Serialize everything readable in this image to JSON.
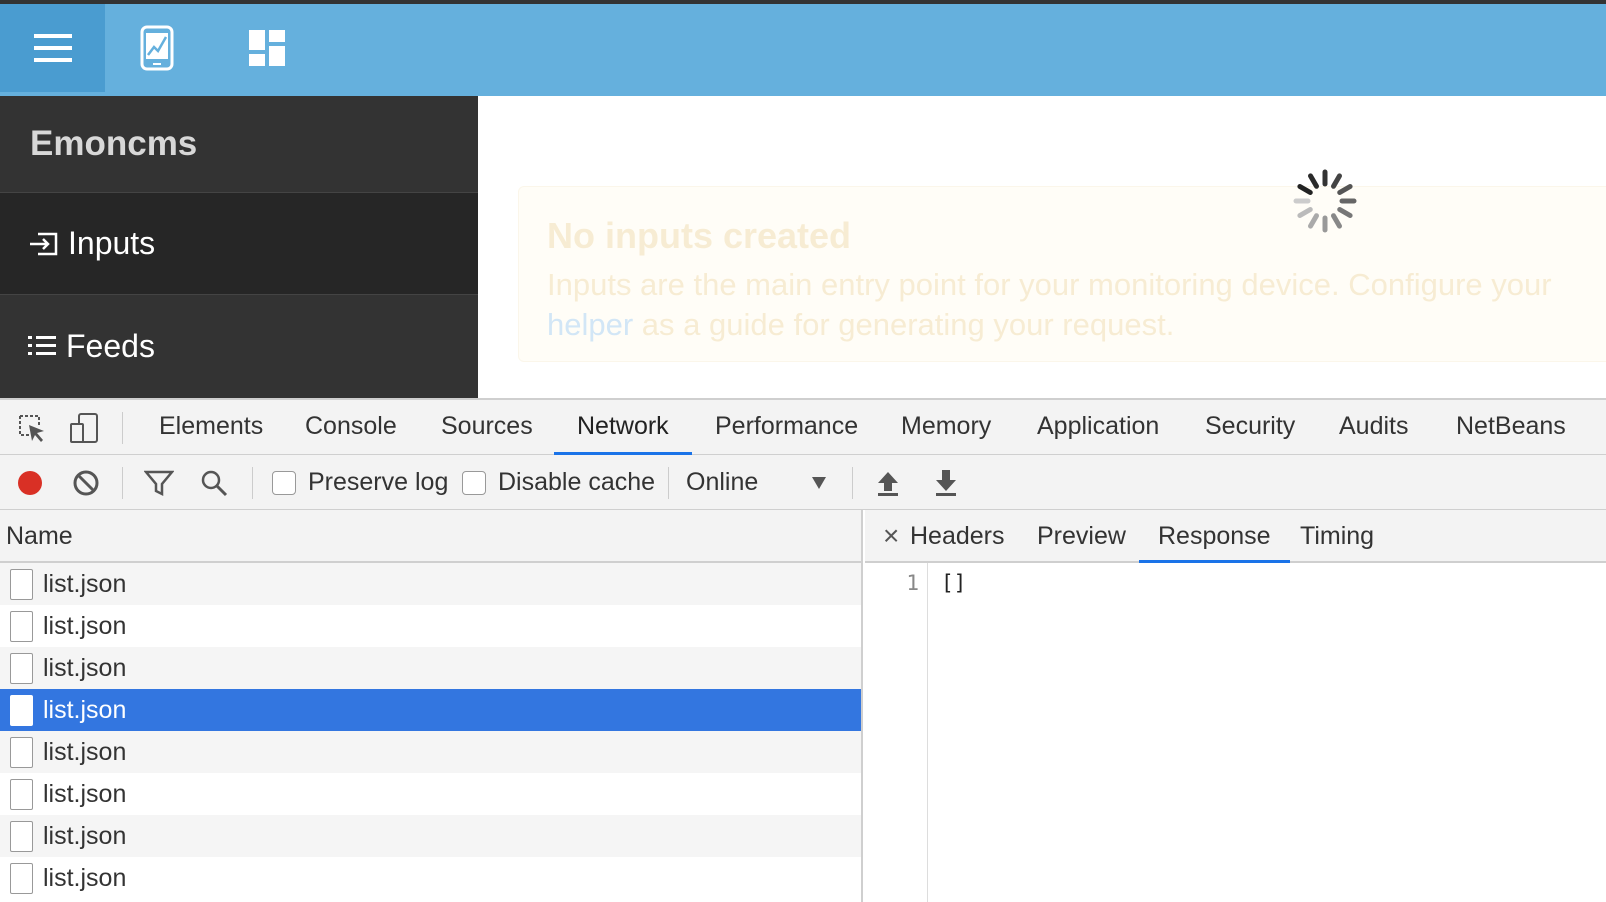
{
  "app": {
    "brand": "Emoncms",
    "topbar_icons": [
      "menu-icon",
      "mobile-chart-icon",
      "dashboard-icon"
    ],
    "sidebar": {
      "items": [
        {
          "label": "Inputs",
          "icon": "input-icon",
          "active": true
        },
        {
          "label": "Feeds",
          "icon": "list-icon",
          "active": false
        }
      ]
    },
    "alert": {
      "title": "No inputs created",
      "body_line1": "Inputs are the main entry point for your monitoring device. Configure your",
      "link": "helper",
      "body_line2": " as a guide for generating your request."
    },
    "colors": {
      "topbar": "#65b0dd",
      "sidebar": "#333333",
      "accent": "#1a73e8",
      "selected_row": "#3376e0"
    }
  },
  "devtools": {
    "tabs": [
      "Elements",
      "Console",
      "Sources",
      "Network",
      "Performance",
      "Memory",
      "Application",
      "Security",
      "Audits",
      "NetBeans"
    ],
    "active_tab": "Network",
    "toolbar": {
      "preserve_log": "Preserve log",
      "disable_cache": "Disable cache",
      "throttle": "Online"
    },
    "requests": {
      "header": "Name",
      "rows": [
        "list.json",
        "list.json",
        "list.json",
        "list.json",
        "list.json",
        "list.json",
        "list.json",
        "list.json"
      ],
      "selected_index": 3
    },
    "detail": {
      "close": "×",
      "tabs": [
        "Headers",
        "Preview",
        "Response",
        "Timing"
      ],
      "active_tab": "Response",
      "line_number": "1",
      "response": "[]"
    }
  }
}
